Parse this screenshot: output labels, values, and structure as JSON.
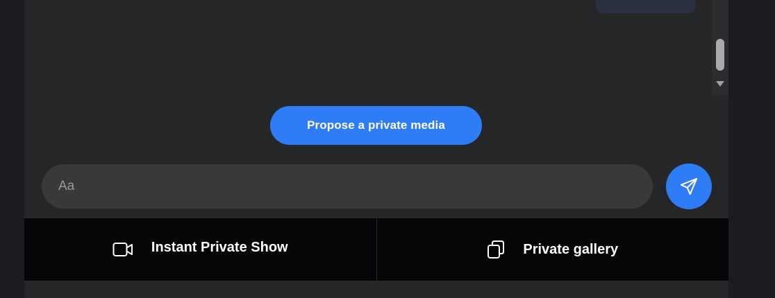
{
  "chat": {
    "propose_button_label": "Propose a private media",
    "input_placeholder": "Aa",
    "input_value": ""
  },
  "icons": {
    "send": "send-icon",
    "video": "video-camera-icon",
    "gallery": "gallery-icon",
    "scroll_down": "scroll-down-arrow-icon"
  },
  "bottom_bar": {
    "tabs": [
      {
        "label": "Instant Private Show",
        "icon": "video-camera-icon"
      },
      {
        "label": "Private gallery",
        "icon": "gallery-icon"
      }
    ]
  },
  "colors": {
    "accent": "#2e7cf6",
    "panel_bg": "#252628",
    "input_bg": "#38393b",
    "bottom_bar_bg": "#050608"
  }
}
